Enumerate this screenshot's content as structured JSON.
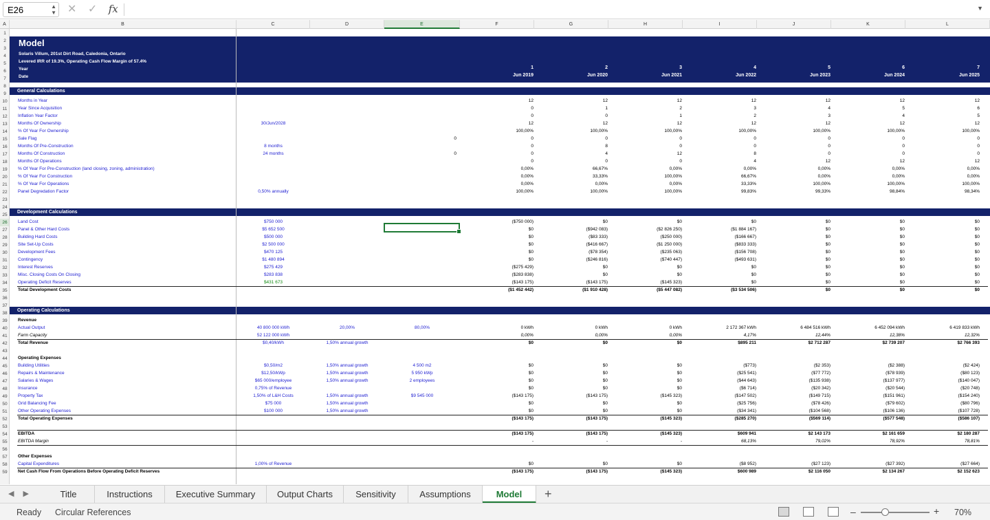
{
  "formula_bar": {
    "cell_ref": "E26",
    "fx_label": "fx",
    "value": ""
  },
  "columns": [
    "A",
    "B",
    "C",
    "D",
    "E",
    "F",
    "G",
    "H",
    "I",
    "J",
    "K",
    "L"
  ],
  "selected_column": "E",
  "rows": [
    "1",
    "2",
    "3",
    "4",
    "5",
    "6",
    "7",
    "8",
    "9",
    "10",
    "11",
    "12",
    "13",
    "14",
    "15",
    "16",
    "17",
    "18",
    "19",
    "20",
    "21",
    "22",
    "23",
    "24",
    "25",
    "26",
    "27",
    "28",
    "29",
    "30",
    "31",
    "32",
    "33",
    "34",
    "35",
    "36",
    "37",
    "38",
    "39",
    "40",
    "41",
    "42",
    "43",
    "44",
    "45",
    "46",
    "47",
    "48",
    "49",
    "50",
    "51",
    "52",
    "53",
    "54",
    "55",
    "56",
    "57",
    "58",
    "59"
  ],
  "selected_row": "26",
  "header": {
    "title": "Model",
    "subtitle1": "Solaris Villum, 201st Dirt Road, Caledonia, Ontario",
    "subtitle2": "Levered IRR of 19.3%, Operating Cash Flow Margin of 57.4%",
    "year_label": "Year",
    "date_label": "Date",
    "years": [
      "1",
      "2",
      "3",
      "4",
      "5",
      "6",
      "7"
    ],
    "dates": [
      "Jun 2019",
      "Jun 2020",
      "Jun 2021",
      "Jun 2022",
      "Jun 2023",
      "Jun 2024",
      "Jun 2025"
    ]
  },
  "sections": {
    "general": "General Calculations",
    "development": "Development Calculations",
    "operating": "Operating Calculations"
  },
  "general_rows": [
    {
      "label": "Months in Year",
      "c": "",
      "d": "",
      "vals": [
        "12",
        "12",
        "12",
        "12",
        "12",
        "12",
        "12"
      ]
    },
    {
      "label": "Year Since Acquisition",
      "c": "",
      "d": "",
      "vals": [
        "0",
        "1",
        "2",
        "3",
        "4",
        "5",
        "6"
      ]
    },
    {
      "label": "Inflation Year Factor",
      "c": "",
      "d": "",
      "vals": [
        "0",
        "0",
        "1",
        "2",
        "3",
        "4",
        "5"
      ]
    },
    {
      "label": "Months Of Ownership",
      "c": "30/Jun/2028",
      "d": "",
      "vals": [
        "12",
        "12",
        "12",
        "12",
        "12",
        "12",
        "12"
      ]
    },
    {
      "label": "% Of Year For Ownership",
      "c": "",
      "d": "",
      "vals": [
        "100,00%",
        "100,00%",
        "100,00%",
        "100,00%",
        "100,00%",
        "100,00%",
        "100,00%"
      ]
    },
    {
      "label": "Sale Flag",
      "c": "",
      "d": "",
      "e": "0",
      "vals": [
        "0",
        "0",
        "0",
        "0",
        "0",
        "0",
        "0"
      ]
    },
    {
      "label": "Months Of Pre-Construction",
      "c": "8 months",
      "d": "",
      "vals": [
        "0",
        "8",
        "0",
        "0",
        "0",
        "0",
        "0"
      ]
    },
    {
      "label": "Months Of Construction",
      "c": "24 months",
      "d": "",
      "e": "0",
      "vals": [
        "0",
        "4",
        "12",
        "8",
        "0",
        "0",
        "0"
      ]
    },
    {
      "label": "Months Of Operations",
      "c": "",
      "d": "",
      "vals": [
        "0",
        "0",
        "0",
        "4",
        "12",
        "12",
        "12"
      ]
    },
    {
      "label": "% Of Year For Pre-Construction (land closing, zoning, administration)",
      "c": "",
      "d": "",
      "vals": [
        "0,00%",
        "66,67%",
        "0,00%",
        "0,00%",
        "0,00%",
        "0,00%",
        "0,00%"
      ]
    },
    {
      "label": "% Of Year For Construction",
      "c": "",
      "d": "",
      "vals": [
        "0,00%",
        "33,33%",
        "100,00%",
        "66,67%",
        "0,00%",
        "0,00%",
        "0,00%"
      ]
    },
    {
      "label": "% Of Year For Operations",
      "c": "",
      "d": "",
      "vals": [
        "0,00%",
        "0,00%",
        "0,00%",
        "33,33%",
        "100,00%",
        "100,00%",
        "100,00%"
      ]
    },
    {
      "label": "Panel Degredation Factor",
      "c": "0,50% annually",
      "d": "",
      "vals": [
        "100,00%",
        "100,00%",
        "100,00%",
        "99,83%",
        "99,33%",
        "98,84%",
        "98,34%"
      ]
    }
  ],
  "development_rows": [
    {
      "label": "Land Cost",
      "c": "$750 000",
      "vals": [
        "($750 000)",
        "$0",
        "$0",
        "$0",
        "$0",
        "$0",
        "$0"
      ]
    },
    {
      "label": "Panel & Other Hard Costs",
      "c": "$5 652 500",
      "vals": [
        "$0",
        "($942 083)",
        "($2 826 250)",
        "($1 884 167)",
        "$0",
        "$0",
        "$0"
      ]
    },
    {
      "label": "Building Hard Costs",
      "c": "$500 000",
      "vals": [
        "$0",
        "($83 333)",
        "($250 000)",
        "($166 667)",
        "$0",
        "$0",
        "$0"
      ]
    },
    {
      "label": "Site Set-Up Costs",
      "c": "$2 500 000",
      "vals": [
        "$0",
        "($416 667)",
        "($1 250 000)",
        "($833 333)",
        "$0",
        "$0",
        "$0"
      ]
    },
    {
      "label": "Development Fees",
      "c": "$470 125",
      "vals": [
        "$0",
        "($78 354)",
        "($235 063)",
        "($156 708)",
        "$0",
        "$0",
        "$0"
      ]
    },
    {
      "label": "Contingency",
      "c": "$1 480 894",
      "vals": [
        "$0",
        "($246 816)",
        "($740 447)",
        "($493 631)",
        "$0",
        "$0",
        "$0"
      ]
    },
    {
      "label": "Interest Reserves",
      "c": "$275 429",
      "vals": [
        "($275 429)",
        "$0",
        "$0",
        "$0",
        "$0",
        "$0",
        "$0"
      ]
    },
    {
      "label": "Misc. Closing Costs On Closing",
      "c": "$283 838",
      "vals": [
        "($283 838)",
        "$0",
        "$0",
        "$0",
        "$0",
        "$0",
        "$0"
      ]
    },
    {
      "label": "Operating Deficit Reserves",
      "c": "$431 673",
      "vals": [
        "($143 175)",
        "($143 175)",
        "($145 323)",
        "$0",
        "$0",
        "$0",
        "$0"
      ]
    }
  ],
  "development_total": {
    "label": "Total Development Costs",
    "vals": [
      "($1 452 442)",
      "($1 910 428)",
      "($5 447 082)",
      "($3 534 506)",
      "$0",
      "$0",
      "$0"
    ]
  },
  "revenue": {
    "head": "Revenue",
    "actual_output": {
      "label": "Actual Output",
      "c": "40 800 000 kWh",
      "d": "20,00%",
      "e": "80,00%",
      "vals": [
        "0 kWh",
        "0 kWh",
        "0 kWh",
        "2 172 367 kWh",
        "6 484 516 kWh",
        "6 452 094 kWh",
        "6 419 833 kWh"
      ]
    },
    "farm_capacity": {
      "label": "Farm Capacity",
      "c": "52 122 000 kWh",
      "vals": [
        "0,00%",
        "0,00%",
        "0,00%",
        "4,17%",
        "12,44%",
        "12,38%",
        "12,32%"
      ]
    },
    "total": {
      "label": "Total Revenue",
      "c": "$0,40/kWh",
      "d": "1,50% annual growth",
      "vals": [
        "$0",
        "$0",
        "$0",
        "$895 211",
        "$2 712 287",
        "$2 739 207",
        "$2 766 393"
      ]
    }
  },
  "opex": {
    "head": "Operating Expenses",
    "rows": [
      {
        "label": "Building Utilities",
        "c": "$0,50/m2",
        "d": "1,50% annual growth",
        "e": "4 500 m2",
        "vals": [
          "$0",
          "$0",
          "$0",
          "($773)",
          "($2 353)",
          "($2 388)",
          "($2 424)"
        ]
      },
      {
        "label": "Repairs & Maintenance",
        "c": "$12,50/kWp",
        "d": "1,50% annual growth",
        "e": "5 950 kWp",
        "vals": [
          "$0",
          "$0",
          "$0",
          "($25 541)",
          "($77 772)",
          "($78 939)",
          "($80 123)"
        ]
      },
      {
        "label": "Salaries & Wages",
        "c": "$65 000/employee",
        "d": "1,50% annual growth",
        "e": "2 employees",
        "vals": [
          "$0",
          "$0",
          "$0",
          "($44 643)",
          "($135 938)",
          "($137 977)",
          "($140 047)"
        ]
      },
      {
        "label": "Insurance",
        "c": "0,75% of Revenue",
        "d": "",
        "e": "",
        "vals": [
          "$0",
          "$0",
          "$0",
          "($6 714)",
          "($20 342)",
          "($20 544)",
          "($20 748)"
        ]
      },
      {
        "label": "Property Tax",
        "c": "1,50% of L&H Costs",
        "d": "1,50% annual growth",
        "e": "$9 545 000",
        "vals": [
          "($143 175)",
          "($143 175)",
          "($145 323)",
          "($147 502)",
          "($149 715)",
          "($151 961)",
          "($154 240)"
        ]
      },
      {
        "label": "Grid Balancing Fee",
        "c": "$75 000",
        "d": "1,50% annual growth",
        "e": "",
        "vals": [
          "$0",
          "$0",
          "$0",
          "($25 756)",
          "($78 426)",
          "($79 602)",
          "($80 796)"
        ]
      },
      {
        "label": "Other Operating Expenses",
        "c": "$100 000",
        "d": "1,50% annual growth",
        "e": "",
        "vals": [
          "$0",
          "$0",
          "$0",
          "($34 341)",
          "($104 568)",
          "($106 136)",
          "($107 728)"
        ]
      }
    ],
    "total": {
      "label": "Total Operating Expenses",
      "vals": [
        "($143 175)",
        "($143 175)",
        "($145 323)",
        "($285 270)",
        "($569 114)",
        "($577 548)",
        "($586 107)"
      ]
    }
  },
  "ebitda": {
    "label": "EBITDA",
    "vals": [
      "($143 175)",
      "($143 175)",
      "($145 323)",
      "$609 941",
      "$2 143 173",
      "$2 161 659",
      "$2 180 287"
    ]
  },
  "ebitda_margin": {
    "label": "EBITDA Margin",
    "vals": [
      "-",
      "-",
      "-",
      "68,13%",
      "79,02%",
      "78,92%",
      "78,81%"
    ]
  },
  "other_expenses": {
    "head": "Other Expenses",
    "capex": {
      "label": "Capital Expenditures",
      "c": "1,00% of Revenue",
      "vals": [
        "$0",
        "$0",
        "$0",
        "($8 952)",
        "($27 123)",
        "($27 392)",
        "($27 664)"
      ]
    },
    "net": {
      "label": "Net Cash Flow From Operations Before Operating Deficit Reserves",
      "vals": [
        "($143 175)",
        "($143 175)",
        "($145 323)",
        "$600 989",
        "$2 116 050",
        "$2 134 267",
        "$2 152 623"
      ]
    }
  },
  "tabs": [
    {
      "label": "Title",
      "active": false
    },
    {
      "label": "Instructions",
      "active": false
    },
    {
      "label": "Executive Summary",
      "active": false
    },
    {
      "label": "Output Charts",
      "active": false
    },
    {
      "label": "Sensitivity",
      "active": false
    },
    {
      "label": "Assumptions",
      "active": false
    },
    {
      "label": "Model",
      "active": true
    }
  ],
  "status": {
    "ready": "Ready",
    "circular": "Circular References",
    "zoom": "70%"
  }
}
